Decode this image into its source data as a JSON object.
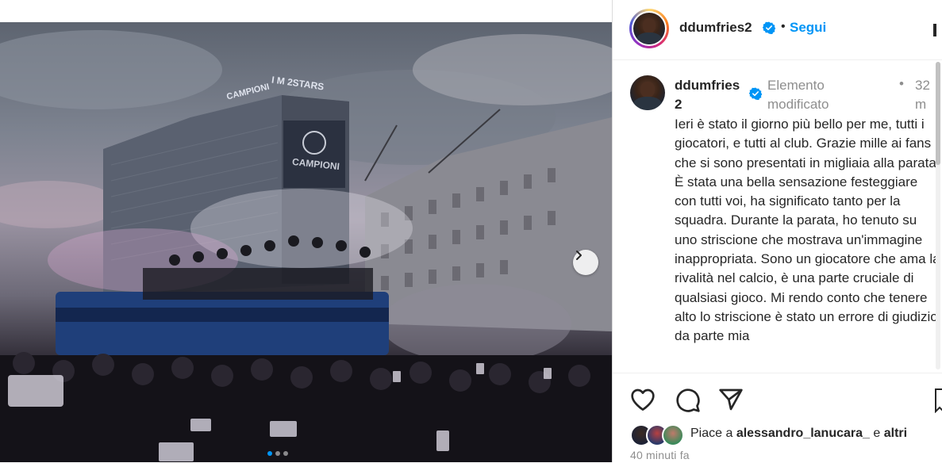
{
  "post": {
    "username": "ddumfries2",
    "follow_separator": "•",
    "follow_label": "Segui"
  },
  "caption": {
    "username_line1": "ddumfries",
    "username_line2": "2",
    "edited_label": "Elemento modificato",
    "time_dot": "•",
    "time_short": "32 m",
    "text": "Ieri è stato il giorno più bello per me, tutti i giocatori, e tutti al club. Grazie mille ai fans che si sono presentati in migliaia alla parata. È stata una bella sensazione festeggiare con tutti voi, ha significato tanto per la squadra. Durante la parata, ho tenuto su uno striscione che mostrava un'immagine inappropriata. Sono un giocatore che ama la rivalità nel calcio, è una parte cruciale di qualsiasi gioco. Mi rendo conto che tenere alto lo striscione è stato un errore di giudizio da parte mia"
  },
  "photo": {
    "building_sign_top": "I M 2STARS",
    "building_sign_campioni_top": "CAMPIONI",
    "building_sign_banner": "CAMPIONI",
    "carousel_dots": 3,
    "carousel_active_index": 0
  },
  "actions": {
    "likes_prefix": "Piace a",
    "likes_user": "alessandro_lanucara_",
    "likes_conj": "e",
    "likes_others": "altri",
    "time_ago": "40 minuti fa"
  },
  "colors": {
    "accent": "#0095f6",
    "text": "#262626",
    "muted": "#8e8e8e"
  },
  "icons": [
    "heart-icon",
    "comment-icon",
    "share-icon",
    "bookmark-icon",
    "verified-icon",
    "chevron-right-icon",
    "more-icon"
  ]
}
